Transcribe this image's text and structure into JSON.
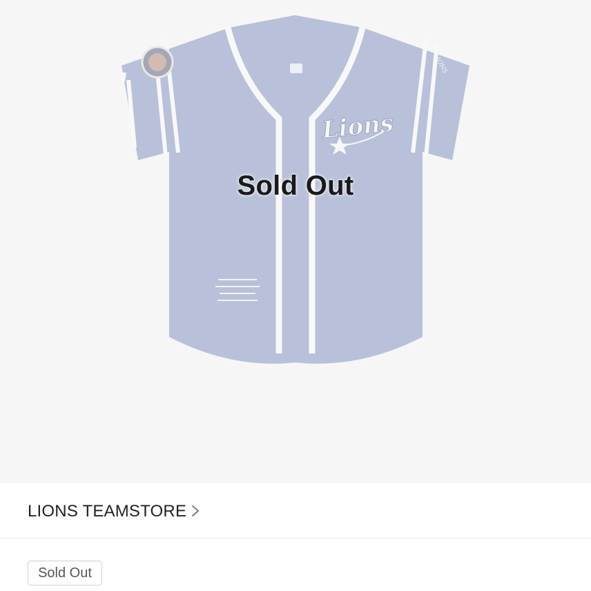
{
  "product": {
    "overlay_text": "Sold Out",
    "jersey_wordmark": "Lions",
    "jersey_color": "#a5b0cf",
    "trim_color": "#f7f7f7"
  },
  "store": {
    "name": "LIONS TEAMSTORE",
    "chevron_icon": "chevron-right-icon"
  },
  "status": {
    "badge": "Sold Out"
  }
}
